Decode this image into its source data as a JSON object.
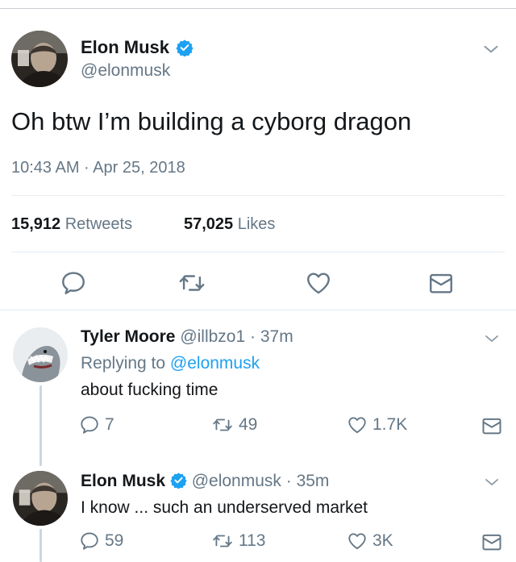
{
  "main_tweet": {
    "author_name": "Elon Musk",
    "handle": "@elonmusk",
    "text": "Oh btw I’m building a cyborg dragon",
    "timestamp": "10:43 AM · Apr 25, 2018",
    "retweet_count": "15,912",
    "retweet_label": "Retweets",
    "like_count": "57,025",
    "like_label": "Likes"
  },
  "replies": [
    {
      "author_name": "Tyler Moore",
      "handle": "@illbzo1",
      "time": "· 37m",
      "replying_prefix": "Replying to",
      "replying_handle": "@elonmusk",
      "text": "about fucking time",
      "reply_count": "7",
      "retweet_count": "49",
      "like_count": "1.7K"
    },
    {
      "author_name": "Elon Musk",
      "handle": "@elonmusk",
      "time": "· 35m",
      "text": "I know ... such an underserved market",
      "reply_count": "59",
      "retweet_count": "113",
      "like_count": "3K"
    }
  ],
  "colors": {
    "accent": "#1da1f2",
    "secondary_text": "#657786",
    "primary_text": "#14171a",
    "divider": "#e6ecf0"
  },
  "icons": [
    "reply-icon",
    "retweet-icon",
    "like-icon",
    "direct-message-icon",
    "chevron-down-icon",
    "verified-badge-icon"
  ]
}
